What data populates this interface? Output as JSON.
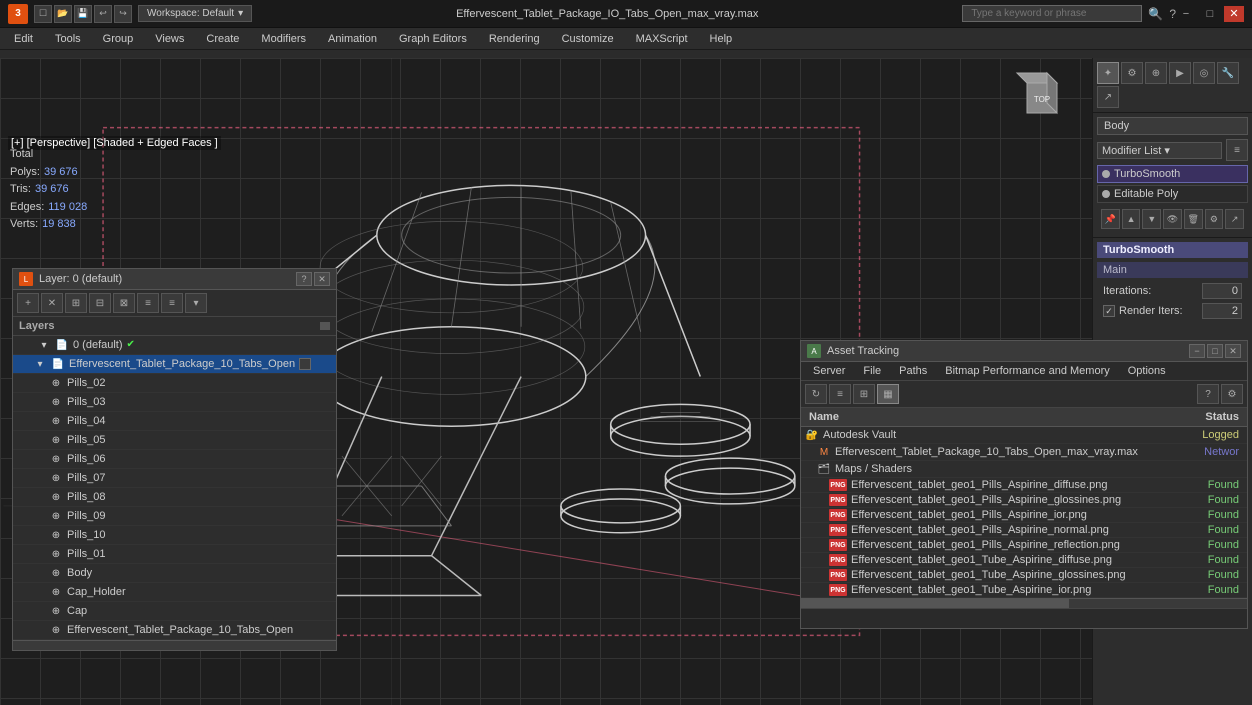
{
  "titlebar": {
    "app_icon": "3",
    "workspace_label": "Workspace: Default",
    "file_title": "Effervescent_Tablet_Package_IO_Tabs_Open_max_vray.max",
    "search_placeholder": "Type a keyword or phrase",
    "min_label": "−",
    "max_label": "□",
    "close_label": "✕"
  },
  "menubar": {
    "items": [
      "Edit",
      "Tools",
      "Group",
      "Views",
      "Create",
      "Modifiers",
      "Animation",
      "Graph Editors",
      "Rendering",
      "Customize",
      "MAXScript",
      "Help"
    ]
  },
  "viewport": {
    "label": "[+] [Perspective] [Shaded + Edged Faces ]",
    "stats": {
      "polys_label": "Polys:",
      "polys_value": "39 676",
      "tris_label": "Tris:",
      "tris_value": "39 676",
      "edges_label": "Edges:",
      "edges_value": "119 028",
      "verts_label": "Verts:",
      "verts_value": "19 838",
      "total_label": "Total"
    }
  },
  "right_panel": {
    "body_label": "Body",
    "modifier_list_label": "Modifier List",
    "turbo_smooth_label": "TurboSmooth",
    "editable_poly_label": "Editable Poly",
    "turbosmooth_panel": {
      "title": "TurboSmooth",
      "section_main": "Main",
      "iterations_label": "Iterations:",
      "iterations_value": "0",
      "render_iters_label": "Render Iters:",
      "render_iters_value": "2"
    }
  },
  "layers_dialog": {
    "title": "Layer: 0 (default)",
    "help_btn": "?",
    "close_btn": "✕",
    "layers_header": "Layers",
    "rows": [
      {
        "label": "0 (default)",
        "indent": 0,
        "checked": true,
        "selected": false
      },
      {
        "label": "Effervescent_Tablet_Package_10_Tabs_Open",
        "indent": 1,
        "checked": false,
        "selected": true
      },
      {
        "label": "Pills_02",
        "indent": 2,
        "checked": false,
        "selected": false
      },
      {
        "label": "Pills_03",
        "indent": 2,
        "checked": false,
        "selected": false
      },
      {
        "label": "Pills_04",
        "indent": 2,
        "checked": false,
        "selected": false
      },
      {
        "label": "Pills_05",
        "indent": 2,
        "checked": false,
        "selected": false
      },
      {
        "label": "Pills_06",
        "indent": 2,
        "checked": false,
        "selected": false
      },
      {
        "label": "Pills_07",
        "indent": 2,
        "checked": false,
        "selected": false
      },
      {
        "label": "Pills_08",
        "indent": 2,
        "checked": false,
        "selected": false
      },
      {
        "label": "Pills_09",
        "indent": 2,
        "checked": false,
        "selected": false
      },
      {
        "label": "Pills_10",
        "indent": 2,
        "checked": false,
        "selected": false
      },
      {
        "label": "Pills_01",
        "indent": 2,
        "checked": false,
        "selected": false
      },
      {
        "label": "Body",
        "indent": 2,
        "checked": false,
        "selected": false
      },
      {
        "label": "Cap_Holder",
        "indent": 2,
        "checked": false,
        "selected": false
      },
      {
        "label": "Cap",
        "indent": 2,
        "checked": false,
        "selected": false
      },
      {
        "label": "Effervescent_Tablet_Package_10_Tabs_Open",
        "indent": 2,
        "checked": false,
        "selected": false
      }
    ]
  },
  "asset_dialog": {
    "title": "Asset Tracking",
    "min_label": "−",
    "max_label": "□",
    "close_label": "✕",
    "menu_items": [
      "Server",
      "File",
      "Paths",
      "Bitmap Performance and Memory",
      "Options"
    ],
    "table": {
      "col_name": "Name",
      "col_status": "Status"
    },
    "rows": [
      {
        "name": "Autodesk Vault",
        "status": "Logged",
        "status_class": "logged",
        "indent": 0,
        "icon": "vault"
      },
      {
        "name": "Effervescent_Tablet_Package_10_Tabs_Open_max_vray.max",
        "status": "Networ",
        "status_class": "network",
        "indent": 1,
        "icon": "max"
      },
      {
        "name": "Maps / Shaders",
        "status": "",
        "status_class": "",
        "indent": 1,
        "icon": "maps"
      },
      {
        "name": "Effervescent_tablet_geo1_Pills_Aspirine_diffuse.png",
        "status": "Found",
        "status_class": "found",
        "indent": 2,
        "icon": "png"
      },
      {
        "name": "Effervescent_tablet_geo1_Pills_Aspirine_glossines.png",
        "status": "Found",
        "status_class": "found",
        "indent": 2,
        "icon": "png"
      },
      {
        "name": "Effervescent_tablet_geo1_Pills_Aspirine_ior.png",
        "status": "Found",
        "status_class": "found",
        "indent": 2,
        "icon": "png"
      },
      {
        "name": "Effervescent_tablet_geo1_Pills_Aspirine_normal.png",
        "status": "Found",
        "status_class": "found",
        "indent": 2,
        "icon": "png"
      },
      {
        "name": "Effervescent_tablet_geo1_Pills_Aspirine_reflection.png",
        "status": "Found",
        "status_class": "found",
        "indent": 2,
        "icon": "png"
      },
      {
        "name": "Effervescent_tablet_geo1_Tube_Aspirine_diffuse.png",
        "status": "Found",
        "status_class": "found",
        "indent": 2,
        "icon": "png"
      },
      {
        "name": "Effervescent_tablet_geo1_Tube_Aspirine_glossines.png",
        "status": "Found",
        "status_class": "found",
        "indent": 2,
        "icon": "png"
      },
      {
        "name": "Effervescent_tablet_geo1_Tube_Aspirine_ior.png",
        "status": "Found",
        "status_class": "found",
        "indent": 2,
        "icon": "png"
      }
    ]
  }
}
